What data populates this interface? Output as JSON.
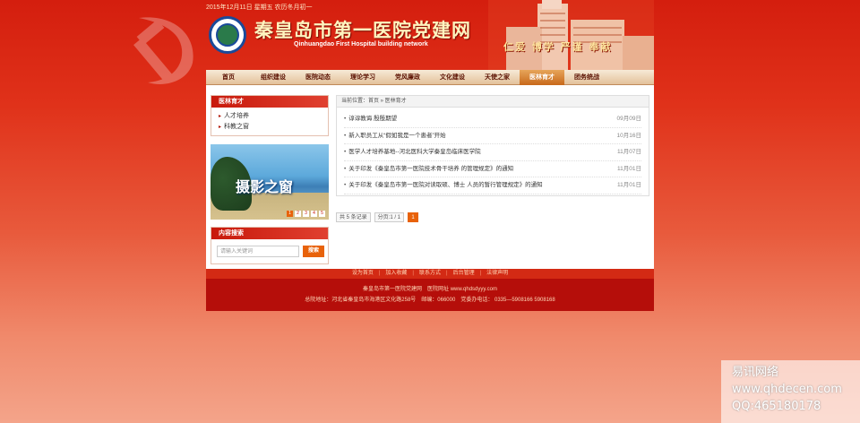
{
  "header": {
    "date": "2015年12月11日 星期五 农历冬月初一",
    "title": "秦皇岛市第一医院党建网",
    "subtitle": "Qinhuangdao First Hospital building network",
    "slogan": "仁爱 博学 严谨 奉献"
  },
  "nav": {
    "items": [
      "首页",
      "组织建设",
      "医院动态",
      "理论学习",
      "党风廉政",
      "文化建设",
      "天使之家",
      "医林育才",
      "团务统战"
    ],
    "active_index": 7
  },
  "sidebar": {
    "title": "医林育才",
    "items": [
      "人才培养",
      "科教之窗"
    ],
    "photo": {
      "caption": "摄影之窗",
      "dots": [
        "1",
        "2",
        "3",
        "4",
        "5"
      ],
      "active_dot": 0
    }
  },
  "search": {
    "title": "内容搜索",
    "placeholder": "请输入关键词",
    "button": "搜索"
  },
  "content": {
    "breadcrumb": "当前位置：首页 » 医林育才",
    "articles": [
      {
        "title": "谆谆教诲 殷殷期望",
        "date": "09月09日"
      },
      {
        "title": "新入职员工从“假如我是一个患者”开始",
        "date": "10月16日"
      },
      {
        "title": "医学人才培养基地--河北医科大学秦皇岛临床医学院",
        "date": "11月07日"
      },
      {
        "title": "关于印发《秦皇岛市第一医院技术骨干培养 的管理规定》的通知",
        "date": "11月01日"
      },
      {
        "title": "关于印发《秦皇岛市第一医院对读取硕、博士 人员的暂行管理规定》的通知",
        "date": "11月01日"
      }
    ],
    "pager": {
      "total": "共 5 条记录",
      "pages": "分页:1 / 1",
      "current": "1"
    }
  },
  "footer": {
    "links": [
      "设为首页",
      "加入收藏",
      "联系方式",
      "后台管理",
      "法律声明"
    ],
    "line1": "秦皇岛市第一医院党建网　医院网址 www.qhdsdyyy.com",
    "line2": "总院地址：河北省秦皇岛市海港区文化路258号　邮编：066000　党委办电话： 0335—5908166 5908168"
  },
  "watermark": {
    "line1": "易讯网络",
    "line2": "www.qhdecen.com",
    "line3": "QQ:465180178"
  },
  "colors": {
    "primary_red": "#c8190b",
    "accent_orange": "#e8620a",
    "footer_red": "#b50e0a"
  }
}
